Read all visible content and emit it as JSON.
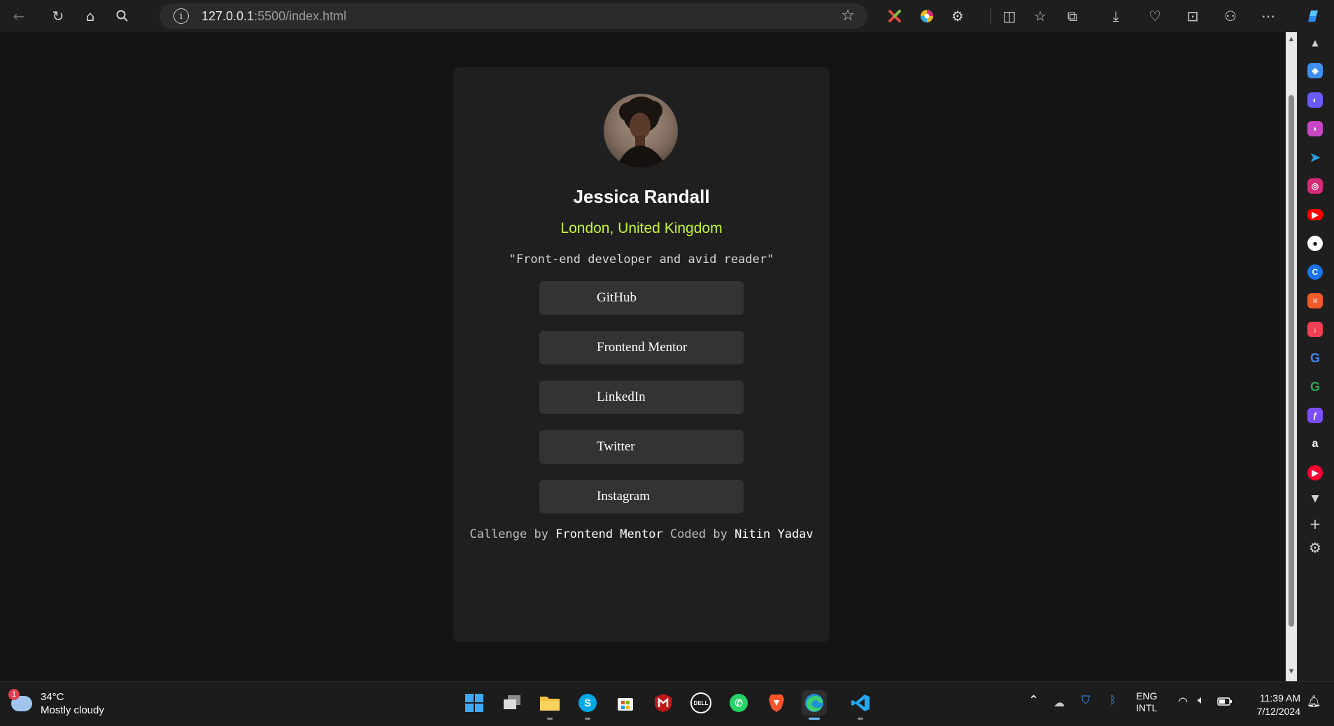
{
  "browser": {
    "url_host": "127.0.0.1",
    "url_rest": ":5500/index.html"
  },
  "profile": {
    "name": "Jessica Randall",
    "location": "London, United Kingdom",
    "bio": "\"Front-end developer and avid reader\"",
    "links": [
      "GitHub",
      "Frontend Mentor",
      "LinkedIn",
      "Twitter",
      "Instagram"
    ],
    "footer": {
      "part1": "Callenge by ",
      "part2": "Frontend Mentor",
      "part3": " Coded by ",
      "part4": "Nitin Yadav"
    }
  },
  "taskbar": {
    "weather_temp": "34°C",
    "weather_desc": "Mostly cloudy",
    "weather_badge": "1",
    "lang_top": "ENG",
    "lang_bottom": "INTL",
    "time": "11:39 AM",
    "date": "7/12/2024"
  }
}
